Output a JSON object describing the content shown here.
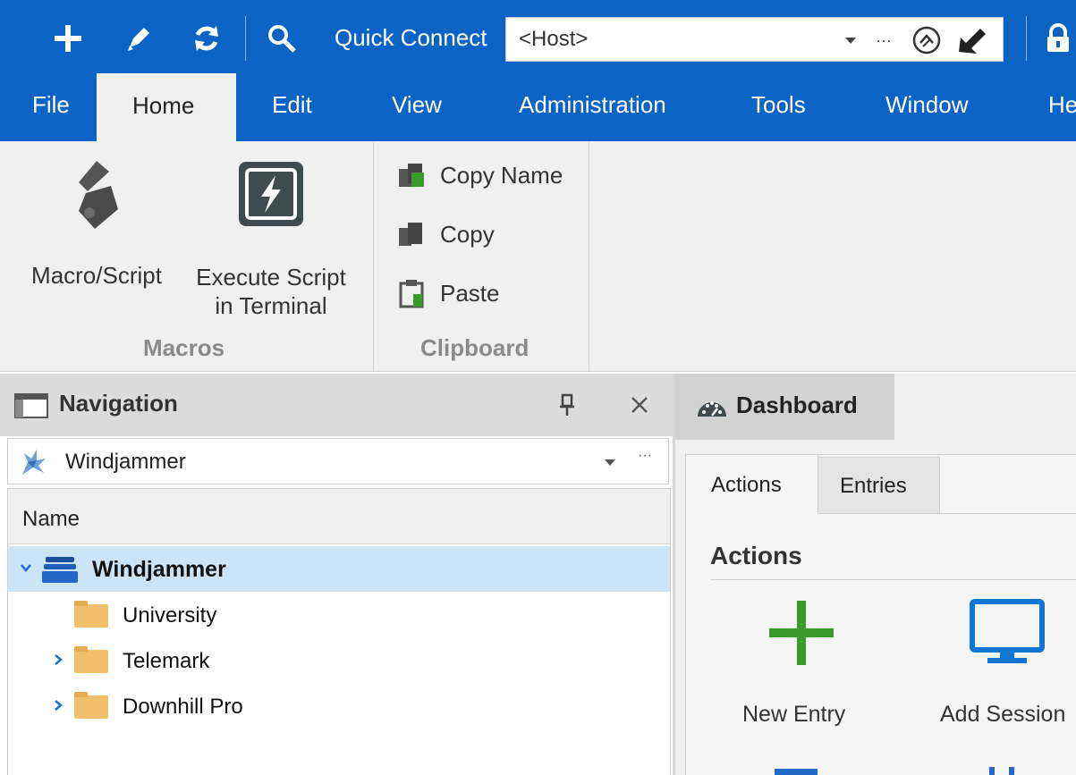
{
  "toolbar": {
    "add_icon": "plus-icon",
    "edit_icon": "pencil-icon",
    "refresh_icon": "refresh-icon",
    "search_icon": "search-icon",
    "quick_connect_label": "Quick Connect",
    "host_placeholder": "<Host>",
    "more_label": "···",
    "accent": "#0b63c5"
  },
  "menu": {
    "items": [
      "File",
      "Home",
      "Edit",
      "View",
      "Administration",
      "Tools",
      "Window",
      "He"
    ],
    "active": "Home"
  },
  "ribbon": {
    "macros": {
      "macro_script_label": "Macro/Script",
      "execute_label_line1": "Execute Script",
      "execute_label_line2": "in Terminal",
      "group_label": "Macros"
    },
    "clipboard": {
      "copy_name_label": "Copy Name",
      "copy_label": "Copy",
      "paste_label": "Paste",
      "group_label": "Clipboard"
    }
  },
  "navigation": {
    "title": "Navigation",
    "pin_icon": "pin-icon",
    "close_icon": "close-icon",
    "datasource": "Windjammer",
    "datasource_more": "···",
    "column_header": "Name",
    "tree": [
      {
        "label": "Windjammer",
        "level": 0,
        "expanded": true,
        "selected": true,
        "icon": "database-icon"
      },
      {
        "label": "University",
        "level": 1,
        "expandable": false,
        "icon": "folder-icon"
      },
      {
        "label": "Telemark",
        "level": 1,
        "expandable": true,
        "icon": "folder-icon"
      },
      {
        "label": "Downhill Pro",
        "level": 1,
        "expandable": true,
        "icon": "folder-icon"
      }
    ]
  },
  "dashboard": {
    "tab_label": "Dashboard",
    "inner_tabs": [
      "Actions",
      "Entries"
    ],
    "active_inner_tab": "Actions",
    "section_title": "Actions",
    "actions": [
      {
        "label": "New Entry",
        "icon": "plus-icon",
        "color": "#3a9b2a"
      },
      {
        "label": "Add Session",
        "icon": "monitor-icon",
        "color": "#1177d2"
      }
    ]
  }
}
